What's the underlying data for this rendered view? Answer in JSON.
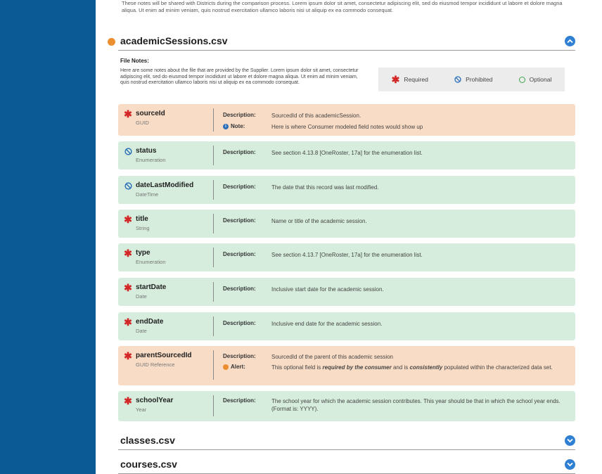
{
  "intro_text": "These notes will be shared with Districts during the comparison process. Lorem ipsum dolor sit amet, consectetur adipiscing elit, sed do eiusmod tempor incididunt ut labore et dolore magna aliqua. Ut enim ad minim veniam, quis nostrud exercitation ullamco laboris nisi ut aliquip ex ea commodo consequat.",
  "sections": [
    {
      "title": "academicSessions.csv",
      "expanded": true
    },
    {
      "title": "classes.csv",
      "expanded": false
    },
    {
      "title": "courses.csv",
      "expanded": false
    }
  ],
  "file_notes": {
    "title": "File Notes:",
    "text": "Here are some notes about the file that are provided by the Supplier. Lorem ipsum dolor sit amet, consectetur adipiscing elit, sed do eiusmod tempor incididunt ut labore et dolore magna aliqua. Ut enim ad minim veniam, quis nostrud exercitation ullamco laboris nisi ut aliquip ex ea commodo consequat."
  },
  "legend": {
    "required": "Required",
    "prohibited": "Prohibited",
    "optional": "Optional"
  },
  "labels": {
    "description": "Description:",
    "note": "Note:",
    "alert": "Alert:"
  },
  "fields": [
    {
      "name": "sourceId",
      "type": "GUID",
      "status": "required",
      "description": "SourcedId of this academicSession.",
      "note": "Here is where Consumer modeled field notes would show up"
    },
    {
      "name": "status",
      "type": "Enumeration",
      "status": "prohibited",
      "description": "See section 4.13.8 [OneRoster, 17a] for the enumeration list."
    },
    {
      "name": "dateLastModified",
      "type": "DateTime",
      "status": "prohibited",
      "description": "The date that this record was last modified."
    },
    {
      "name": "title",
      "type": "String",
      "status": "required",
      "description": "Name or title of the academic session."
    },
    {
      "name": "type",
      "type": "Enumeration",
      "status": "required",
      "description": "See section 4.13.7 [OneRoster, 17a] for the enumeration list."
    },
    {
      "name": "startDate",
      "type": "Date",
      "status": "required",
      "description": "Inclusive start date for the academic session."
    },
    {
      "name": "endDate",
      "type": "Date",
      "status": "required",
      "description": "Inclusive end date for the academic session."
    },
    {
      "name": "parentSourcedId",
      "type": "GUID Reference",
      "status": "required",
      "description": "SourcedId of the parent of this academic session",
      "alert": {
        "prefix": "This optional field is ",
        "bold1": "required by the consumer",
        "middle": " and is ",
        "bold2": "consistently",
        "suffix": " populated within the characterized data set."
      }
    },
    {
      "name": "schoolYear",
      "type": "Year",
      "status": "required",
      "description": "The school year for which the academic session contributes. This year should be that in which the school year ends. (Format is: YYYY)."
    }
  ],
  "colors": {
    "sidebar": "#0b5a94",
    "accent_orange": "#ec8f30",
    "peach_row": "#f9dcc6",
    "green_row": "#d6eddd",
    "chevron_blue": "#2f7fd3",
    "required_red": "#d32626",
    "optional_green": "#3da84d"
  }
}
